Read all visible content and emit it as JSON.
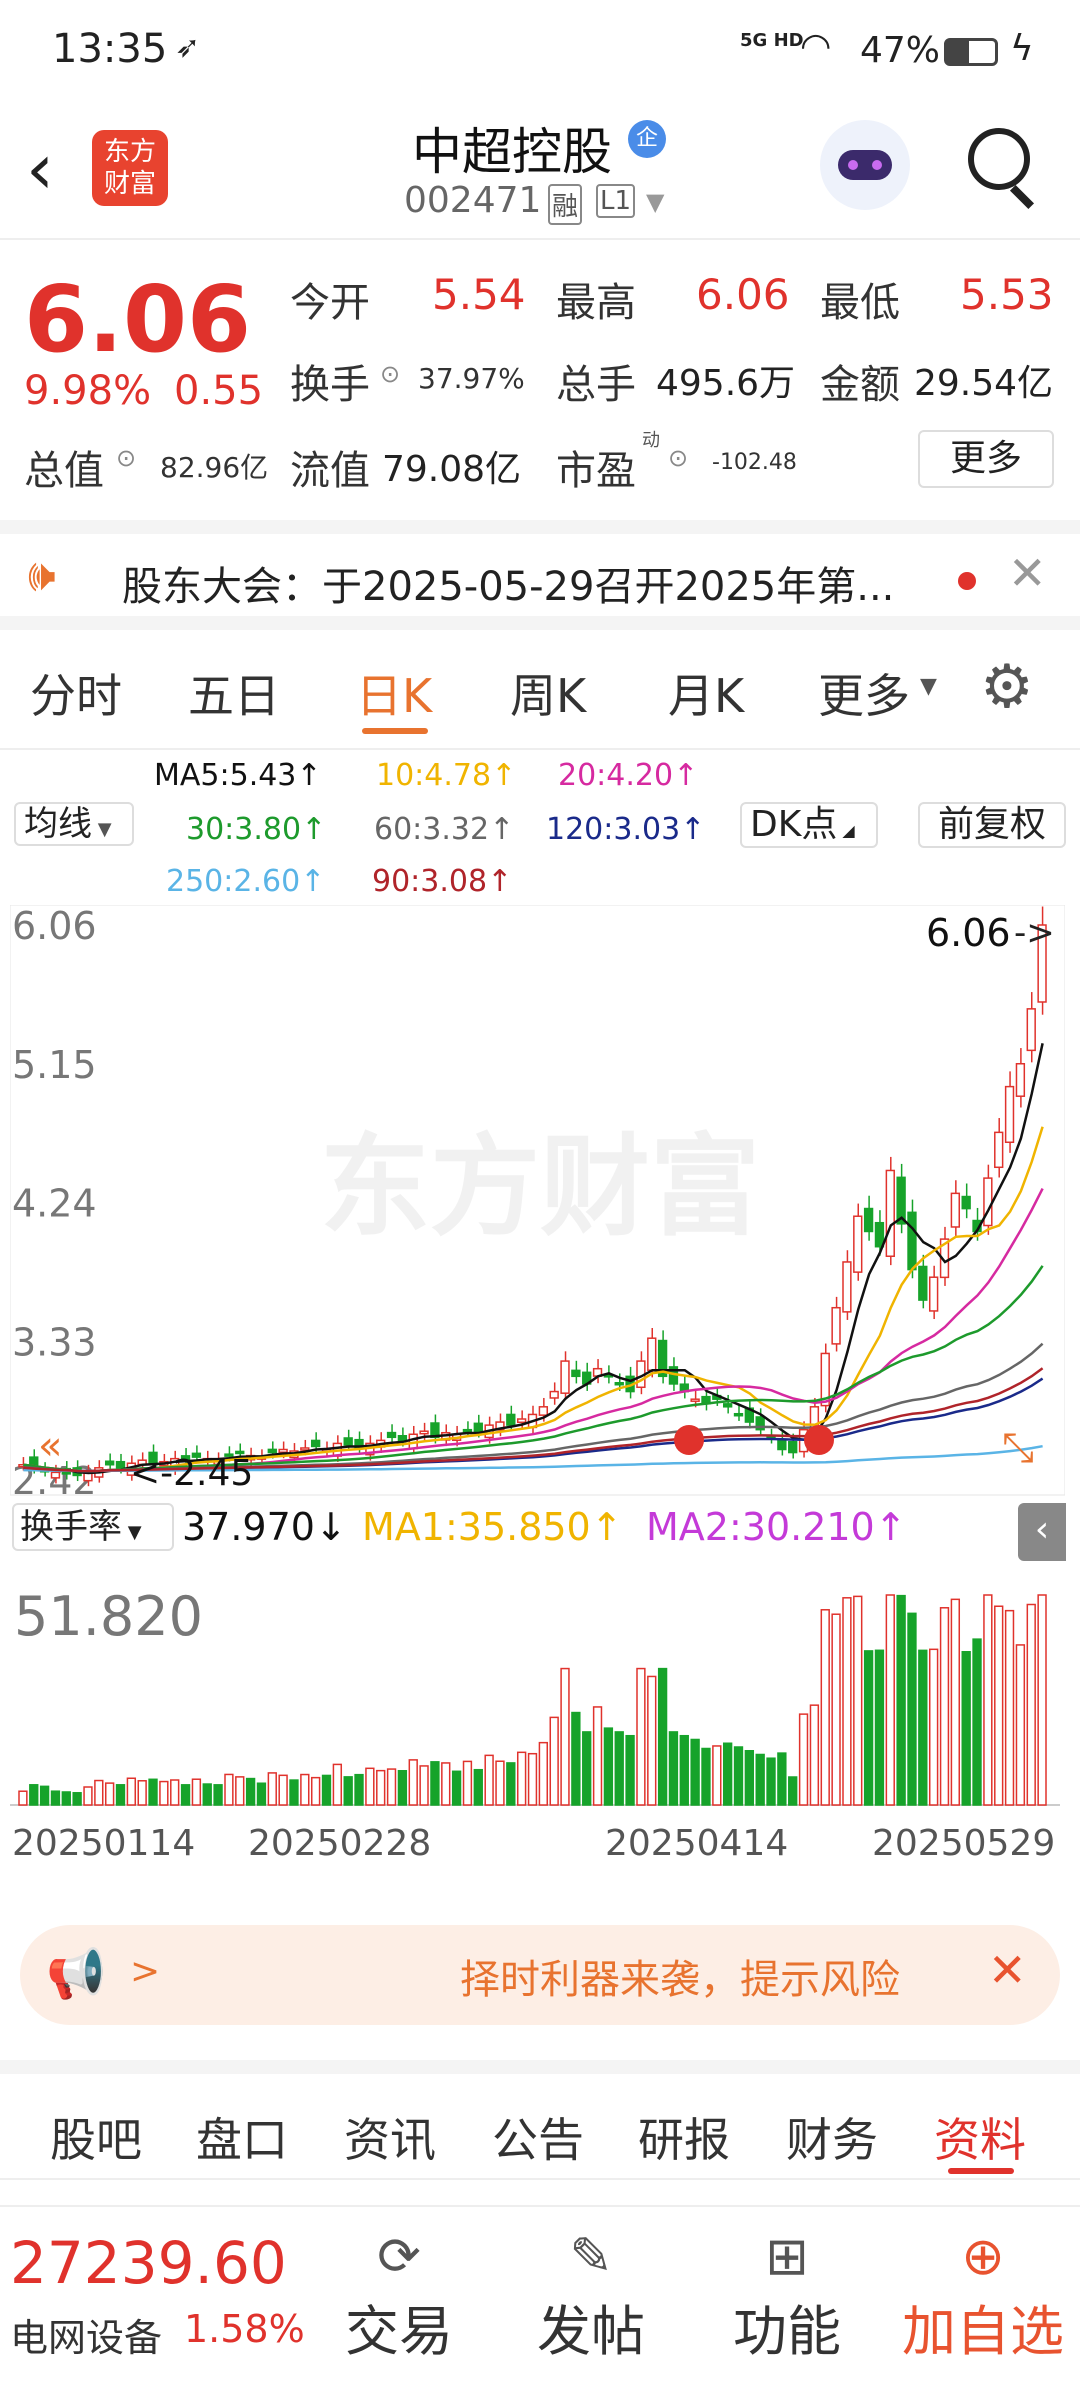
{
  "status_bar": {
    "time": "13:35",
    "network": "5G HD",
    "battery": "47%"
  },
  "header": {
    "title": "中超控股",
    "title_badge": "企",
    "code": "002471",
    "tag1": "融",
    "tag2": "L1",
    "logo_text_1": "东方",
    "logo_text_2": "财富"
  },
  "quote": {
    "price": "6.06",
    "change_pct": "9.98%",
    "change": "0.55",
    "open_label": "今开",
    "open": "5.54",
    "high_label": "最高",
    "high": "6.06",
    "low_label": "最低",
    "low": "5.53",
    "turnover_label": "换手",
    "turnover": "37.97%",
    "volume_label": "总手",
    "volume": "495.6万",
    "amount_label": "金额",
    "amount": "29.54亿",
    "mktcap_label": "总值",
    "mktcap": "82.96亿",
    "float_label": "流值",
    "float_cap": "79.08亿",
    "pe_label": "市盈",
    "pe_sup": "动",
    "pe": "-102.48",
    "more_button": "更多"
  },
  "notice": {
    "text": "股东大会：于2025-05-29召开2025年第..."
  },
  "ktabs": [
    "分时",
    "五日",
    "日K",
    "周K",
    "月K",
    "更多"
  ],
  "ktabs_active": 2,
  "ma": {
    "selector": "均线",
    "ma5": "MA5:5.43↑",
    "ma10": "10:4.78↑",
    "ma20": "20:4.20↑",
    "ma30": "30:3.80↑",
    "ma60": "60:3.32↑",
    "ma120": "120:3.03↑",
    "ma250": "250:2.60↑",
    "ma90": "90:3.08↑",
    "dk_button": "DK点",
    "fq_button": "前复权"
  },
  "chart_data": {
    "type": "candlestick",
    "y_ticks": [
      "6.06",
      "5.15",
      "4.24",
      "3.33",
      "2.42"
    ],
    "ylim": [
      2.42,
      6.06
    ],
    "last_label": "6.06",
    "low_label": "2.45",
    "x_ticks": [
      "20250114",
      "20250228",
      "20250414",
      "20250529"
    ],
    "close": [
      2.52,
      2.5,
      2.48,
      2.47,
      2.46,
      2.45,
      2.47,
      2.5,
      2.52,
      2.5,
      2.53,
      2.55,
      2.52,
      2.54,
      2.56,
      2.55,
      2.57,
      2.56,
      2.55,
      2.58,
      2.6,
      2.58,
      2.57,
      2.6,
      2.62,
      2.61,
      2.63,
      2.64,
      2.62,
      2.66,
      2.65,
      2.63,
      2.66,
      2.68,
      2.7,
      2.68,
      2.72,
      2.74,
      2.7,
      2.73,
      2.72,
      2.75,
      2.74,
      2.78,
      2.8,
      2.78,
      2.82,
      2.85,
      2.9,
      3.0,
      3.2,
      3.1,
      3.05,
      3.15,
      3.1,
      3.05,
      3.0,
      3.2,
      3.35,
      3.1,
      3.05,
      3.0,
      2.95,
      2.92,
      2.95,
      2.9,
      2.85,
      2.8,
      2.75,
      2.7,
      2.62,
      2.6,
      2.75,
      2.9,
      3.25,
      3.55,
      3.85,
      4.15,
      4.05,
      3.95,
      4.45,
      4.1,
      3.8,
      3.6,
      3.75,
      4.0,
      4.3,
      4.2,
      4.05,
      4.4,
      4.7,
      5.0,
      5.15,
      5.51,
      6.06
    ],
    "ma_series": [
      {
        "name": "MA5",
        "color": "#111111"
      },
      {
        "name": "MA10",
        "color": "#f0b400"
      },
      {
        "name": "MA20",
        "color": "#d62aa0"
      },
      {
        "name": "MA30",
        "color": "#1d9a2c"
      },
      {
        "name": "MA60",
        "color": "#666666"
      },
      {
        "name": "MA120",
        "color": "#1a2a8a"
      },
      {
        "name": "MA250",
        "color": "#5ab4e6"
      },
      {
        "name": "MA90",
        "color": "#b0242a"
      }
    ],
    "turnover": {
      "label": "换手率",
      "value": "37.970↓",
      "ma1": "MA1:35.850↑",
      "ma2": "MA2:30.210↑",
      "top": "51.820"
    }
  },
  "banner": {
    "arrow": ">",
    "text": "择时利器来袭，提示风险"
  },
  "tabs2": [
    "股吧",
    "盘口",
    "资讯",
    "公告",
    "研报",
    "财务",
    "资料"
  ],
  "tabs2_active": 6,
  "bottom": {
    "index_value": "27239.60",
    "index_name": "电网设备",
    "index_pct": "1.58%",
    "trade": "交易",
    "post": "发帖",
    "func": "功能",
    "add": "加自选"
  }
}
